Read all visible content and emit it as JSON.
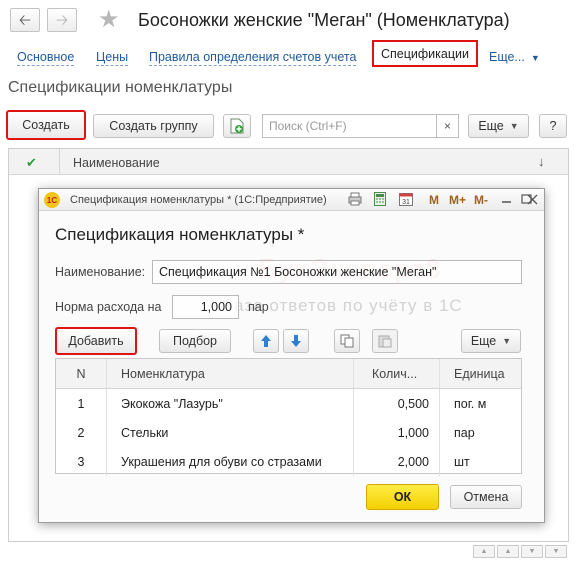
{
  "window": {
    "title": "Босоножки женские \"Меган\" (Номенклатура)"
  },
  "tabs": {
    "items": [
      "Основное",
      "Цены",
      "Правила определения счетов учета"
    ],
    "active": "Спецификации",
    "more": "Еще..."
  },
  "list_page": {
    "subtitle": "Спецификации номенклатуры",
    "create_label": "Создать",
    "create_group_label": "Создать группу",
    "search_placeholder": "Поиск (Ctrl+F)",
    "search_clear": "×",
    "more_label": "Еще",
    "help_label": "?",
    "col_name": "Наименование",
    "sort_glyph": "↓",
    "check_glyph": "✔"
  },
  "dialog": {
    "window_title": "Спецификация номенклатуры * (1С:Предприятие)",
    "toolbar_m": [
      "M",
      "M+",
      "M-"
    ],
    "heading": "Спецификация номенклатуры *",
    "name_label": "Наименование:",
    "name_value": "Спецификация №1 Босоножки женские \"Меган\"",
    "rate_label": "Норма расхода на",
    "rate_value": "1,000",
    "rate_unit": "пар",
    "add_label": "Добавить",
    "pick_label": "Подбор",
    "more_label": "Еще",
    "table": {
      "headers": [
        "N",
        "Номенклатура",
        "Колич...",
        "Единица"
      ],
      "rows": [
        {
          "n": "1",
          "name": "Экокожа \"Лазурь\"",
          "qty": "0,500",
          "unit": "пог. м"
        },
        {
          "n": "2",
          "name": "Стельки",
          "qty": "1,000",
          "unit": "пар"
        },
        {
          "n": "3",
          "name": "Украшения для обуви со стразами",
          "qty": "2,000",
          "unit": "шт"
        }
      ]
    },
    "ok_label": "ОК",
    "cancel_label": "Отмена"
  },
  "watermark": {
    "line1": "БухЭксперт8",
    "line2": "База ответов по учёту в 1С"
  },
  "colors": {
    "highlight": "#e01212",
    "link": "#1f5a9e",
    "ok_button": "#f7dd16",
    "check": "#2e9d3a"
  },
  "icons": [
    "back-arrow-icon",
    "forward-arrow-icon",
    "star-icon",
    "add-file-icon",
    "logo-1c-icon",
    "print-icon",
    "calculator-icon",
    "calendar-icon",
    "arrow-up-icon",
    "arrow-down-icon",
    "copy-icon",
    "paste-icon"
  ]
}
